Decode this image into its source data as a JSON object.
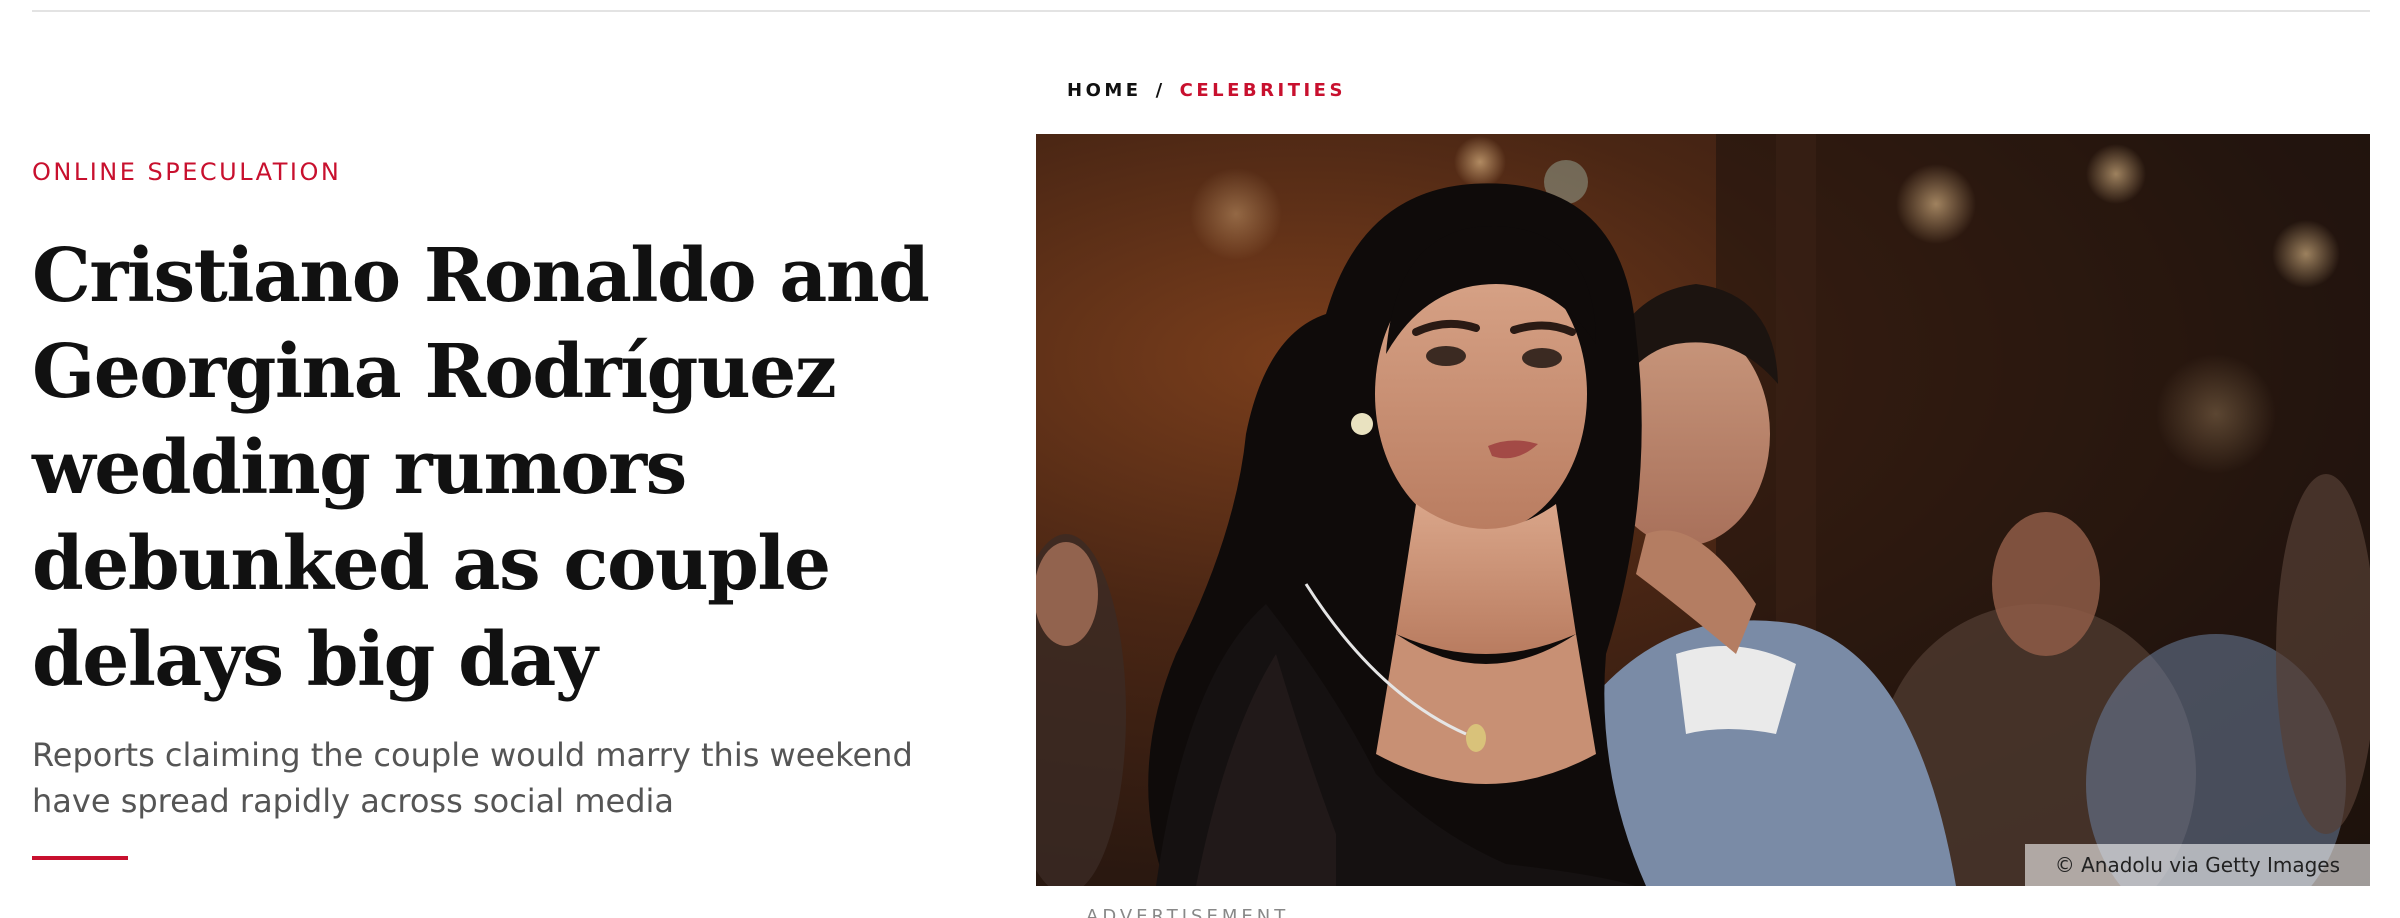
{
  "article": {
    "kicker": "ONLINE SPECULATION",
    "headline_lines": [
      "Cristiano Ronaldo and",
      "Georgina Rodríguez",
      "wedding rumors",
      "debunked as couple",
      "delays big day"
    ],
    "dek_lines": [
      "Reports claiming the couple would marry this weekend",
      "have spread rapidly across social media"
    ]
  },
  "breadcrumb": {
    "home": "HOME",
    "separator": "/",
    "current": "CELEBRITIES"
  },
  "hero_image": {
    "credit": "© Anadolu via Getty Images"
  },
  "advertisement_label": "ADVERTISEMENT",
  "colors": {
    "accent": "#c8102e",
    "text": "#111111",
    "dek": "#555555"
  }
}
